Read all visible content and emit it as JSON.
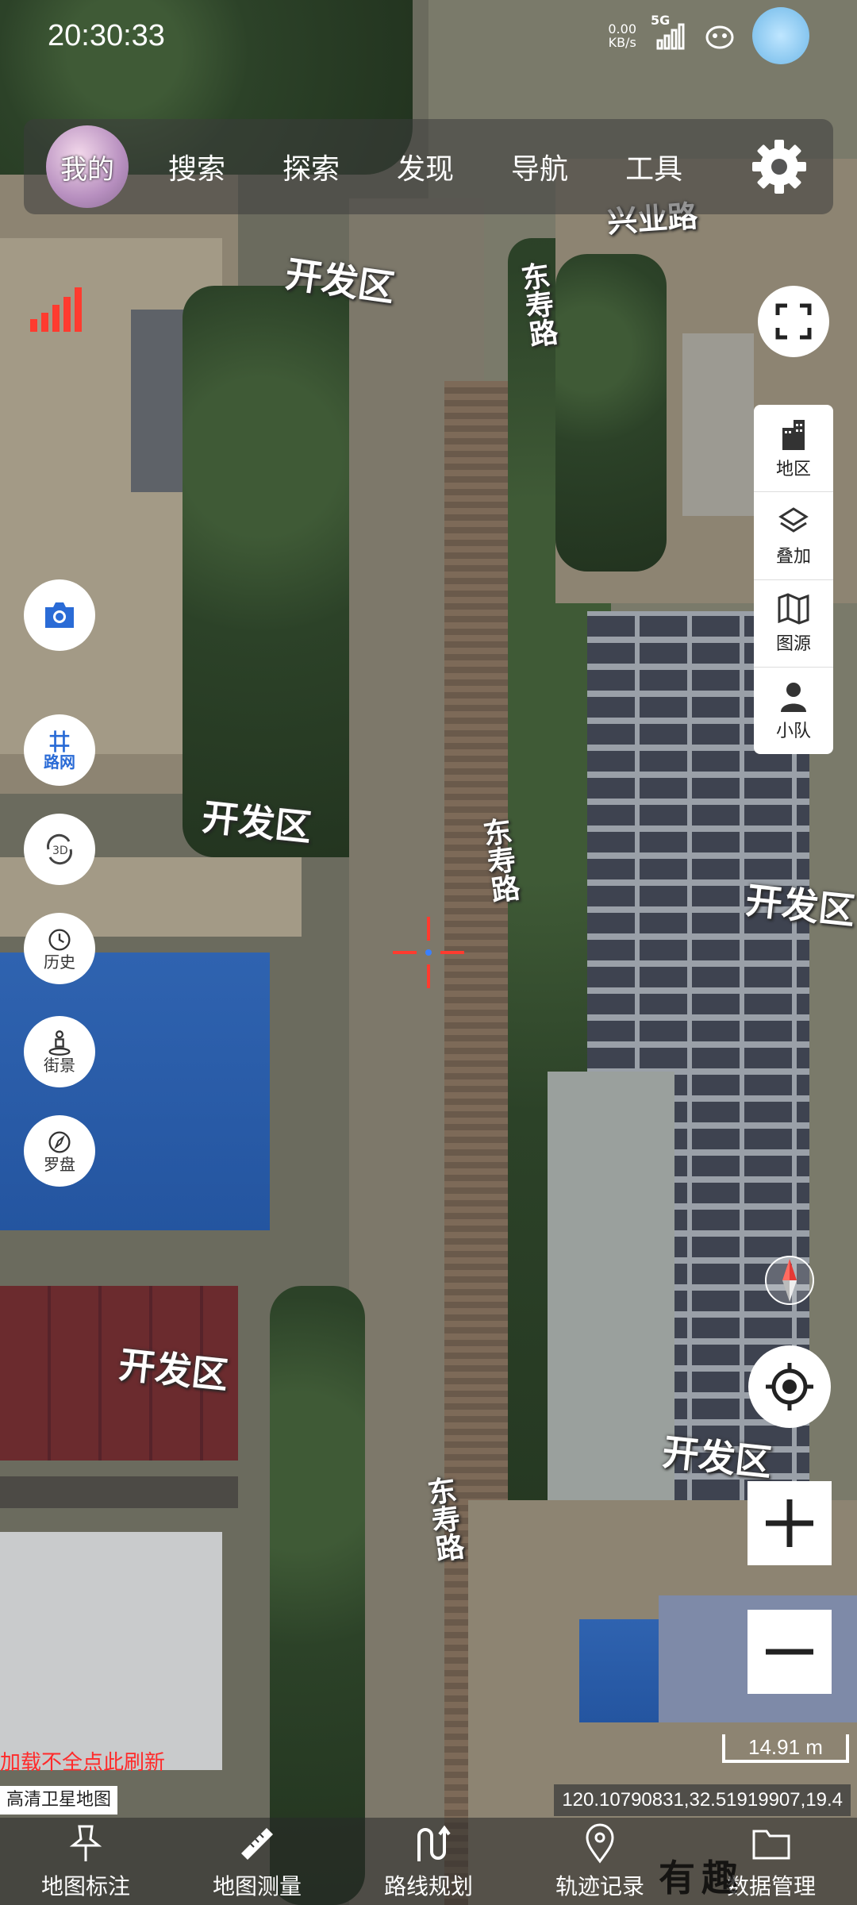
{
  "status_bar": {
    "time": "20:30:33",
    "net_speed_value": "0.00",
    "net_speed_unit": "KB/s",
    "network": "5G"
  },
  "top_nav": {
    "avatar_label": "我的",
    "items": [
      "搜索",
      "探索",
      "发现",
      "导航",
      "工具"
    ]
  },
  "map": {
    "district_labels": [
      "开发区",
      "开发区",
      "开发区",
      "开发区",
      "开发区"
    ],
    "road_top": "兴业路",
    "road_labels": [
      "东寿路",
      "东寿路",
      "东寿路"
    ]
  },
  "layer_panel": {
    "items": [
      "地区",
      "叠加",
      "图源",
      "小队"
    ]
  },
  "left_tools": {
    "route_net": "路网",
    "history": "历史",
    "street_view": "街景",
    "compass": "罗盘"
  },
  "scale": "14.91 m",
  "refresh_hint": "加载不全点此刷新",
  "map_type": "高清卫星地图",
  "coordinates": "120.10790831,32.51919907,19.4",
  "bottom_bar": {
    "items": [
      "地图标注",
      "地图测量",
      "路线规划",
      "轨迹记录",
      "数据管理"
    ]
  },
  "watermark": "有趣"
}
